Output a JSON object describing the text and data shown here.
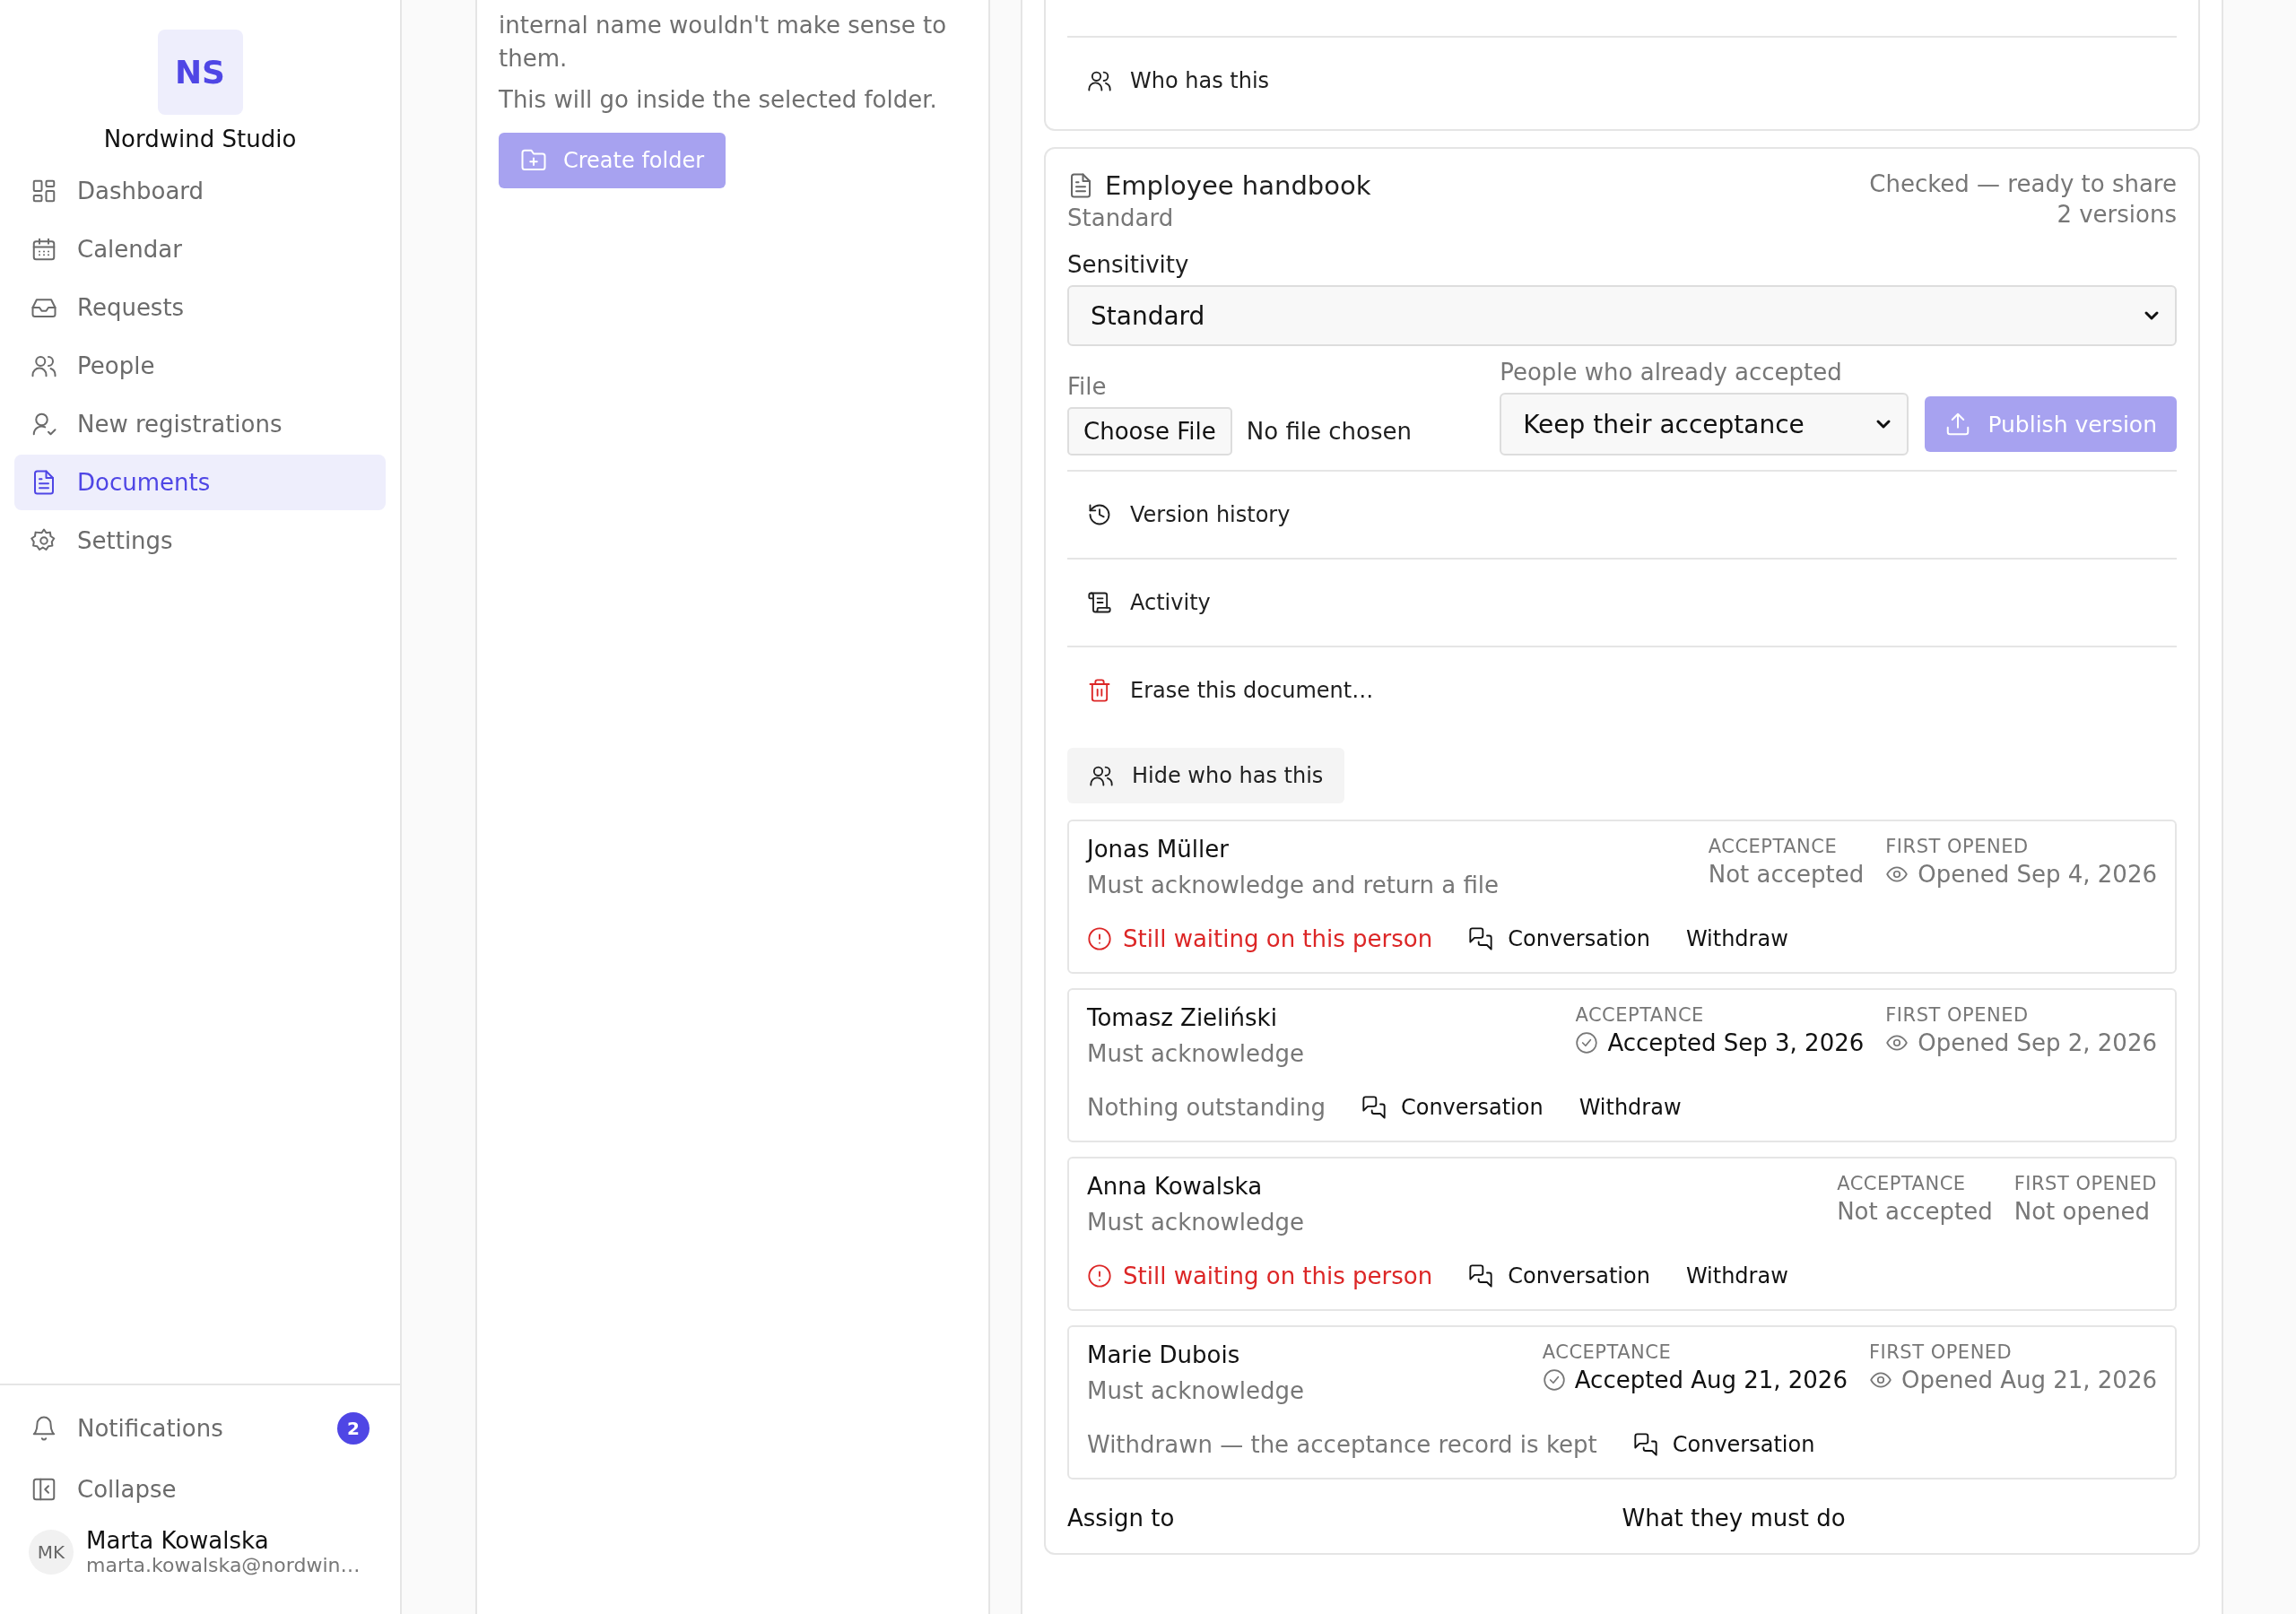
{
  "sidebar": {
    "logo": "NS",
    "org_name": "Nordwind Studio",
    "nav": [
      {
        "kind": "dashboard",
        "label": "Dashboard",
        "selected": false
      },
      {
        "kind": "calendar",
        "label": "Calendar",
        "selected": false
      },
      {
        "kind": "inbox",
        "label": "Requests",
        "selected": false
      },
      {
        "kind": "people",
        "label": "People",
        "selected": false
      },
      {
        "kind": "user-check",
        "label": "New registrations",
        "selected": false
      },
      {
        "kind": "document",
        "label": "Documents",
        "selected": true
      },
      {
        "kind": "settings",
        "label": "Settings",
        "selected": false
      }
    ],
    "notifications": {
      "label": "Notifications",
      "badge": "2"
    },
    "collapse": {
      "label": "Collapse"
    },
    "user": {
      "initials": "MK",
      "name": "Marta Kowalska",
      "email": "marta.kowalska@nordwin…"
    }
  },
  "folder_panel": {
    "description": "internal name wouldn't make sense to them.",
    "hint": "This will go inside the selected folder.",
    "button": {
      "label": "Create folder",
      "disabled": true
    }
  },
  "documents": [
    {
      "actions": [
        {
          "kind": "people",
          "label": "Who has this"
        }
      ]
    },
    {
      "title": "Employee handbook",
      "subtitle": "Standard",
      "status": "Checked — ready to share",
      "versions": "2 versions",
      "sensitivity": {
        "label": "Sensitivity",
        "value": "Standard"
      },
      "file": {
        "label": "File",
        "button": "Choose File",
        "value": "No file chosen"
      },
      "accepted": {
        "label": "People who already accepted",
        "value": "Keep their acceptance"
      },
      "publish": {
        "label": "Publish version",
        "disabled": true
      },
      "actions": [
        {
          "kind": "history",
          "label": "Version history"
        },
        {
          "kind": "activity",
          "label": "Activity"
        },
        {
          "kind": "erase",
          "label": "Erase this document…"
        }
      ],
      "toggle": {
        "label": "Hide who has this"
      },
      "recipients": [
        {
          "name": "Jonas Müller",
          "requirement": "Must acknowledge and return a file",
          "acceptance_label": "ACCEPTANCE",
          "acceptance": "Not accepted",
          "accepted": false,
          "opened_label": "FIRST OPENED",
          "opened": "Opened Sep 4, 2026",
          "was_opened": true,
          "status": {
            "kind": "waiting",
            "text": "Still waiting on this person"
          },
          "conversation": "Conversation",
          "withdraw": "Withdraw"
        },
        {
          "name": "Tomasz Zieliński",
          "requirement": "Must acknowledge",
          "acceptance_label": "ACCEPTANCE",
          "acceptance": "Accepted Sep 3, 2026",
          "accepted": true,
          "opened_label": "FIRST OPENED",
          "opened": "Opened Sep 2, 2026",
          "was_opened": true,
          "status": {
            "kind": "done",
            "text": "Nothing outstanding"
          },
          "conversation": "Conversation",
          "withdraw": "Withdraw"
        },
        {
          "name": "Anna Kowalska",
          "requirement": "Must acknowledge",
          "acceptance_label": "ACCEPTANCE",
          "acceptance": "Not accepted",
          "accepted": false,
          "opened_label": "FIRST OPENED",
          "opened": "Not opened",
          "was_opened": false,
          "status": {
            "kind": "waiting",
            "text": "Still waiting on this person"
          },
          "conversation": "Conversation",
          "withdraw": "Withdraw"
        },
        {
          "name": "Marie Dubois",
          "requirement": "Must acknowledge",
          "acceptance_label": "ACCEPTANCE",
          "acceptance": "Accepted Aug 21, 2026",
          "accepted": true,
          "opened_label": "FIRST OPENED",
          "opened": "Opened Aug 21, 2026",
          "was_opened": true,
          "status": {
            "kind": "withdrawn",
            "text": "Withdrawn — the acceptance record is kept"
          },
          "conversation": "Conversation"
        }
      ],
      "assign": {
        "assign_label": "Assign to",
        "task_label": "What they must do"
      }
    }
  ]
}
